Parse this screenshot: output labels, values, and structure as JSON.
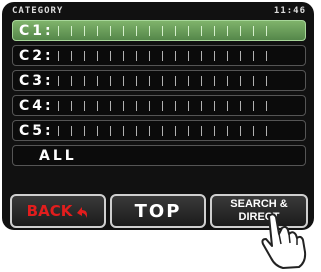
{
  "status": {
    "title": "CATEGORY",
    "time": "11:46"
  },
  "rows": [
    {
      "label": "C1:"
    },
    {
      "label": "C2:"
    },
    {
      "label": "C3:"
    },
    {
      "label": "C4:"
    },
    {
      "label": "C5:"
    },
    {
      "label": "ALL"
    }
  ],
  "buttons": {
    "back": "BACK",
    "top": "TOP",
    "search_line1": "SEARCH &",
    "search_line2": "DIRECT"
  },
  "colors": {
    "selected_row": "#6aa05c",
    "back_text": "#e21d1d"
  }
}
